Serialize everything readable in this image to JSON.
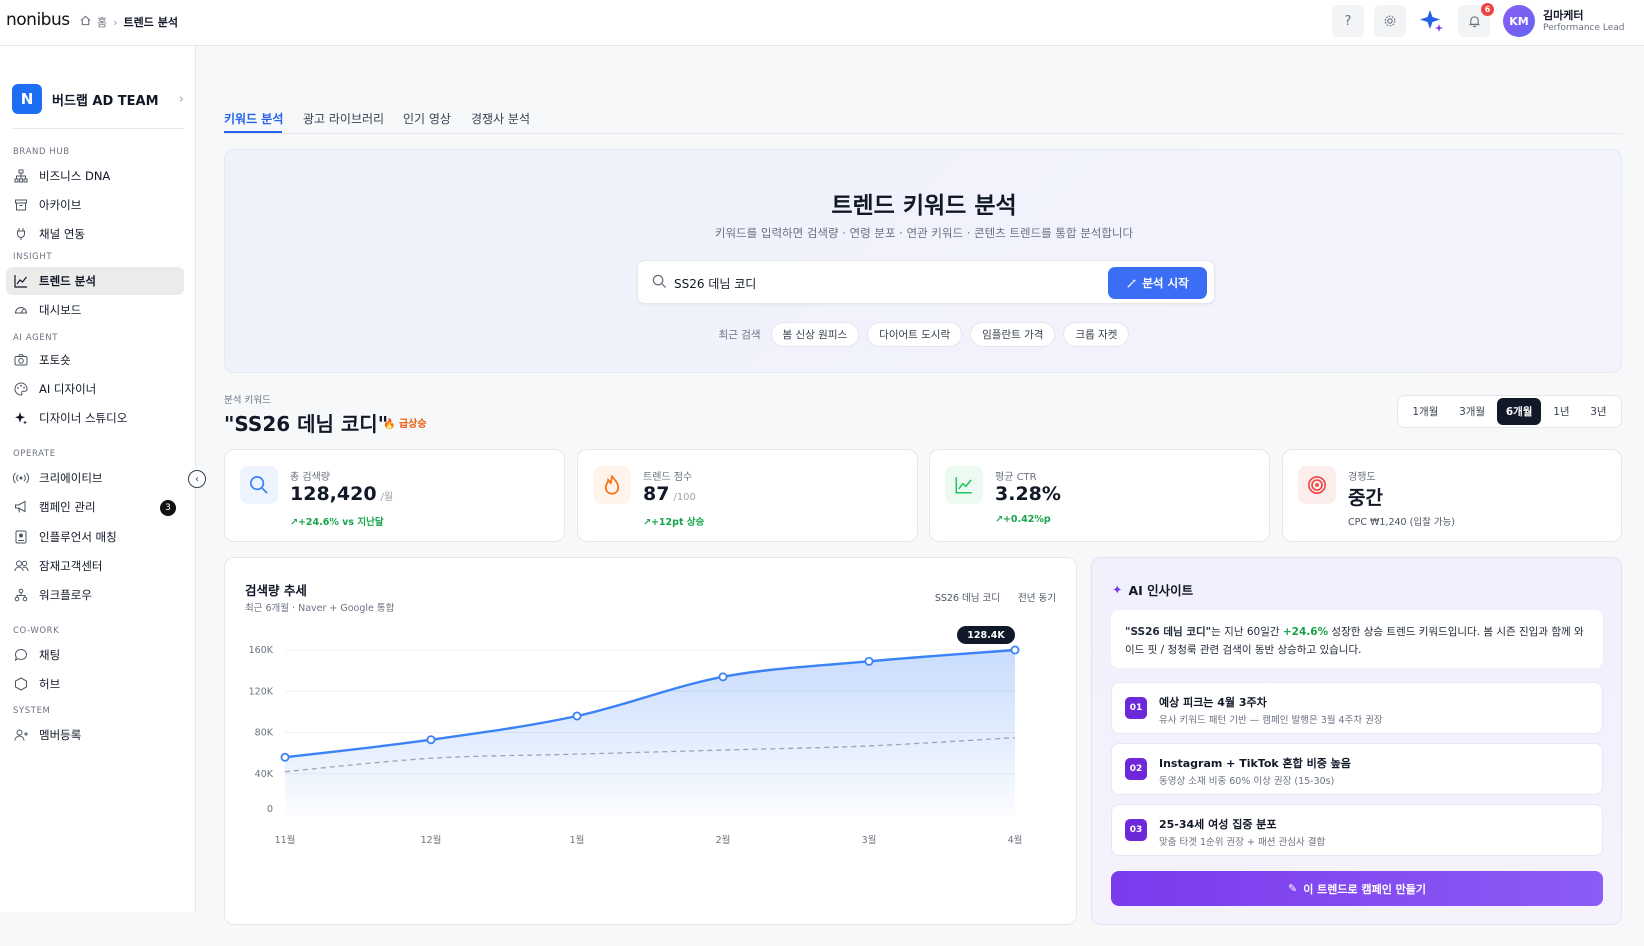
{
  "app": {
    "logo": "nonibus"
  },
  "breadcrumb": {
    "home": "홈",
    "current": "트렌드 분석"
  },
  "header": {
    "notifications": "6",
    "user_initials": "KM",
    "user_name": "김마케터",
    "user_role": "Performance Lead"
  },
  "sidebar": {
    "team_initial": "N",
    "team_name": "버드랩 AD TEAM",
    "sections": [
      "BRAND HUB",
      "INSIGHT",
      "AI AGENT",
      "OPERATE",
      "CO-WORK",
      "SYSTEM"
    ],
    "items": [
      {
        "label": "비즈니스 DNA",
        "icon": "sitemap-icon"
      },
      {
        "label": "아카이브",
        "icon": "archive-icon"
      },
      {
        "label": "채널 연동",
        "icon": "plug-icon"
      },
      {
        "label": "트렌드 분석",
        "icon": "trend-chart-icon",
        "active": true
      },
      {
        "label": "대시보드",
        "icon": "gauge-icon"
      },
      {
        "label": "포토숏",
        "icon": "camera-icon"
      },
      {
        "label": "AI 디자이너",
        "icon": "palette-icon"
      },
      {
        "label": "디자이너 스튜디오",
        "icon": "sparkle-icon"
      },
      {
        "label": "크리에이티브",
        "icon": "broadcast-icon"
      },
      {
        "label": "캠페인 관리",
        "icon": "megaphone-icon",
        "count": "3"
      },
      {
        "label": "인플루언서 매칭",
        "icon": "badge-icon"
      },
      {
        "label": "잠재고객센터",
        "icon": "users-icon"
      },
      {
        "label": "워크플로우",
        "icon": "workflow-icon"
      },
      {
        "label": "채팅",
        "icon": "chat-icon"
      },
      {
        "label": "허브",
        "icon": "hexagon-icon"
      },
      {
        "label": "멤버등록",
        "icon": "user-plus-icon"
      }
    ]
  },
  "tabs": [
    "키워드 분석",
    "광고 라이브러리",
    "인기 영상",
    "경쟁사 분석"
  ],
  "hero": {
    "title": "트렌드 키워드 분석",
    "subtitle": "키워드를 입력하면 검색량 · 연령 분포 · 연관 키워드 · 콘텐츠 트렌드를 통합 분석합니다",
    "query": "SS26 데님 코디",
    "button": "분석 시작",
    "recent_label": "최근 검색",
    "recent": [
      "봄 신상 원피스",
      "다이어트 도시락",
      "임플란트 가격",
      "크롭 자켓"
    ]
  },
  "keyword": {
    "label": "분석 키워드",
    "title": "\"SS26 데님 코디\"",
    "tag": "급상승"
  },
  "ranges": [
    "1개월",
    "3개월",
    "6개월",
    "1년",
    "3년"
  ],
  "selected_range": "6개월",
  "metrics": [
    {
      "label": "총 검색량",
      "value": "128,420",
      "unit": "/월",
      "delta": "↗+24.6% vs 지난달",
      "icon": "search-icon",
      "color": "#3b82f6"
    },
    {
      "label": "트렌드 점수",
      "value": "87",
      "unit": "/100",
      "delta": "↗+12pt 상승",
      "icon": "flame-icon",
      "color": "#f97316"
    },
    {
      "label": "평균 CTR",
      "value": "3.28%",
      "unit": "",
      "delta": "↗+0.42%p",
      "icon": "trend-icon",
      "color": "#22c55e"
    },
    {
      "label": "경쟁도",
      "value": "중간",
      "unit": "",
      "delta": "CPC ₩1,240 (입찰 가능)",
      "icon": "target-icon",
      "color": "#ef4444"
    }
  ],
  "chart": {
    "title": "검색량 추세",
    "subtitle": "최근 6개월 · Naver + Google 통합",
    "legend": [
      "SS26 데님 코디",
      "전년 동기"
    ],
    "peak_label": "128.4K"
  },
  "chart_data": {
    "type": "line",
    "x": [
      "11월",
      "12월",
      "1월",
      "2월",
      "3월",
      "4월"
    ],
    "y_ticks": [
      "0",
      "40K",
      "80K",
      "120K",
      "160K"
    ],
    "ylim": [
      0,
      160000
    ],
    "series": [
      {
        "name": "SS26 데님 코디",
        "points": [
          [
            0,
            56000
          ],
          [
            1,
            73000
          ],
          [
            2,
            96000
          ],
          [
            3,
            134000
          ],
          [
            4,
            149000
          ],
          [
            5,
            160000
          ]
        ],
        "color": "#3b82f6"
      },
      {
        "name": "전년 동기",
        "points": [
          [
            0,
            42000
          ],
          [
            1,
            55000
          ],
          [
            2,
            59000
          ],
          [
            3,
            63000
          ],
          [
            4,
            67000
          ],
          [
            5,
            75000
          ]
        ],
        "color": "#9ca3af",
        "dashed": true
      }
    ]
  },
  "ai": {
    "title": "AI 인사이트",
    "summary_kw": "\"SS26 데님 코디\"",
    "summary_a": "는 지난 60일간 ",
    "summary_pct": "+24.6%",
    "summary_b": " 성장한 상승 트렌드 키워드입니다. 봄 시즌 진입과 함께 와이드 핏 / 청청룩 관련 검색이 동반 상승하고 있습니다.",
    "insights": [
      {
        "num": "01",
        "title": "예상 피크는 4월 3주차",
        "desc": "유사 키워드 패턴 기반 — 캠페인 발행은 3월 4주차 권장"
      },
      {
        "num": "02",
        "title": "Instagram + TikTok 혼합 비중 높음",
        "desc": "동영상 소재 비중 60% 이상 권장 (15-30s)"
      },
      {
        "num": "03",
        "title": "25-34세 여성 집중 분포",
        "desc": "맞춤 타겟 1순위 권장 + 패션 관심사 결합"
      }
    ],
    "button": "이 트렌드로 캠페인 만들기"
  }
}
